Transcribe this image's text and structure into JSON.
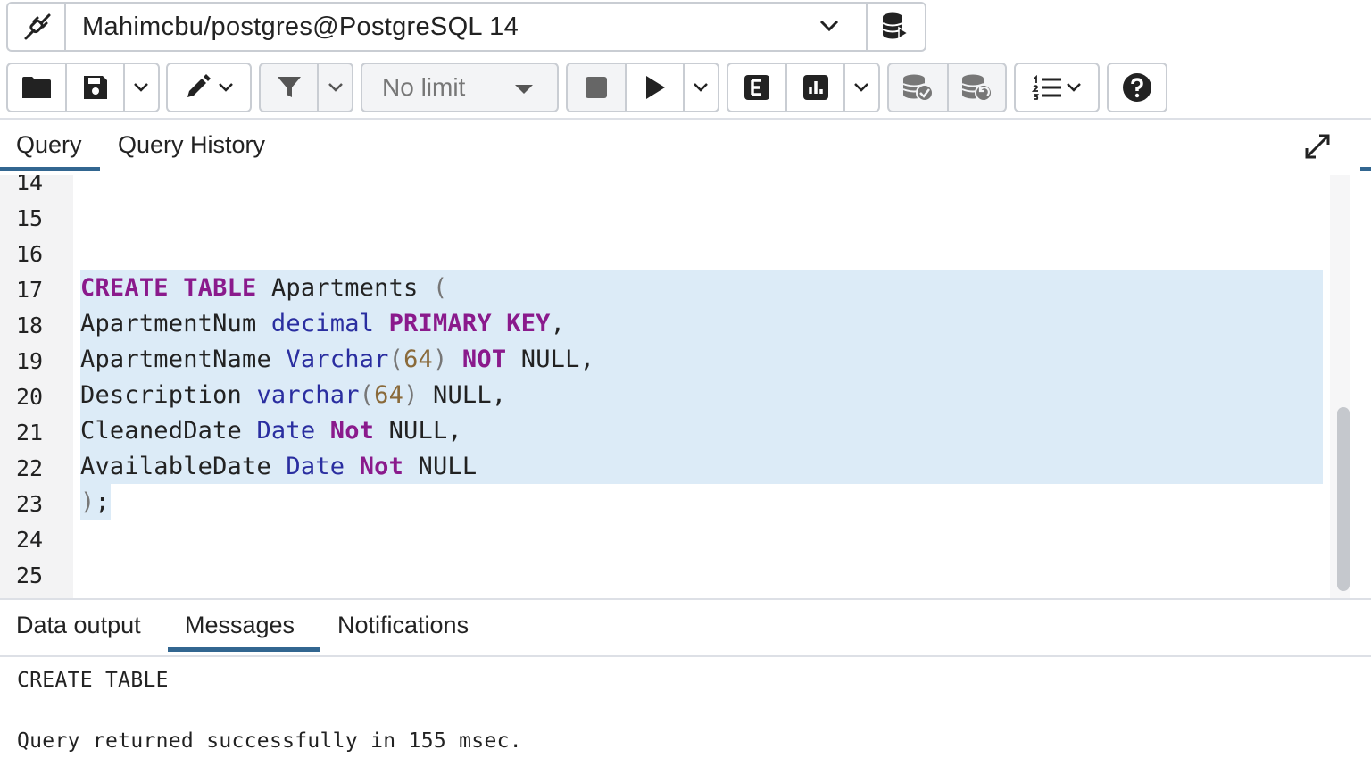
{
  "connection": {
    "label": "Mahimcbu/postgres@PostgreSQL 14",
    "icon": "connection-status-icon",
    "db_button_icon": "database-new-connection-icon"
  },
  "toolbar": {
    "open_icon": "folder-icon",
    "save_icon": "save-icon",
    "edit_icon": "pen-icon",
    "filter_icon": "filter-icon",
    "limit_value": "No limit",
    "stop_icon": "stop-icon",
    "execute_icon": "play-icon",
    "explain_icon": "explain-icon",
    "explain_analyze_icon": "explain-analyze-icon",
    "commit_icon": "commit-icon",
    "rollback_icon": "rollback-icon",
    "macros_icon": "list-icon",
    "help_icon": "help-icon"
  },
  "query_tabs": [
    {
      "label": "Query",
      "active": true
    },
    {
      "label": "Query History",
      "active": false
    }
  ],
  "editor": {
    "line_numbers": [
      "14",
      "15",
      "16",
      "17",
      "18",
      "19",
      "20",
      "21",
      "22",
      "23",
      "24",
      "25"
    ]
  },
  "output_tabs": [
    {
      "label": "Data output",
      "active": false
    },
    {
      "label": "Messages",
      "active": true
    },
    {
      "label": "Notifications",
      "active": false
    }
  ],
  "messages": {
    "line1": "CREATE TABLE",
    "line2": "Query returned successfully in 155 msec."
  },
  "colors": {
    "accent": "#326690",
    "keyword": "#8a1a8c",
    "type": "#2a2ea0",
    "number": "#8a6a3a",
    "selection": "#dcebf7"
  }
}
